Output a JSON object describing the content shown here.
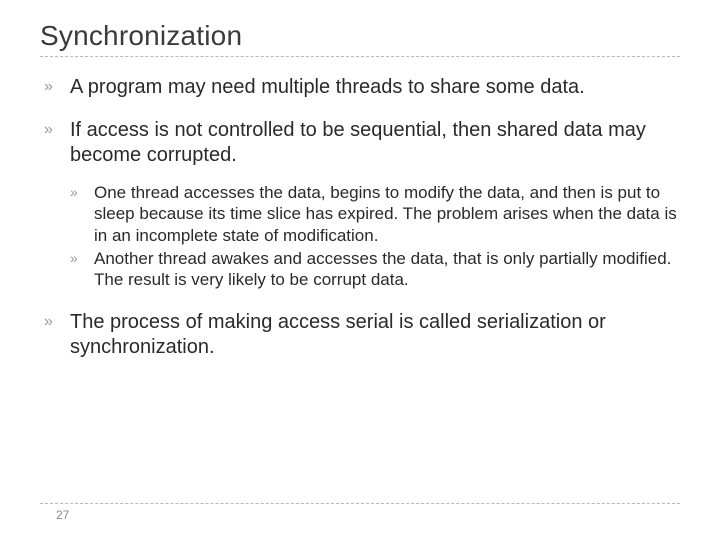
{
  "title": "Synchronization",
  "bullet_glyph": "»",
  "items": [
    {
      "text": "A program may need multiple threads to share some data."
    },
    {
      "text": "If access is not controlled to be sequential, then shared data may become corrupted.",
      "sub": [
        {
          "text": "One thread accesses the data, begins to modify the data, and then is put to sleep because its time slice has expired. The problem arises when the data is in an incomplete state of modification."
        },
        {
          "text": "Another thread awakes and accesses the data, that is only partially modified.  The result is very likely to be corrupt data."
        }
      ]
    },
    {
      "text": "The process of making access serial is called serialization or synchronization."
    }
  ],
  "page_number": "27"
}
